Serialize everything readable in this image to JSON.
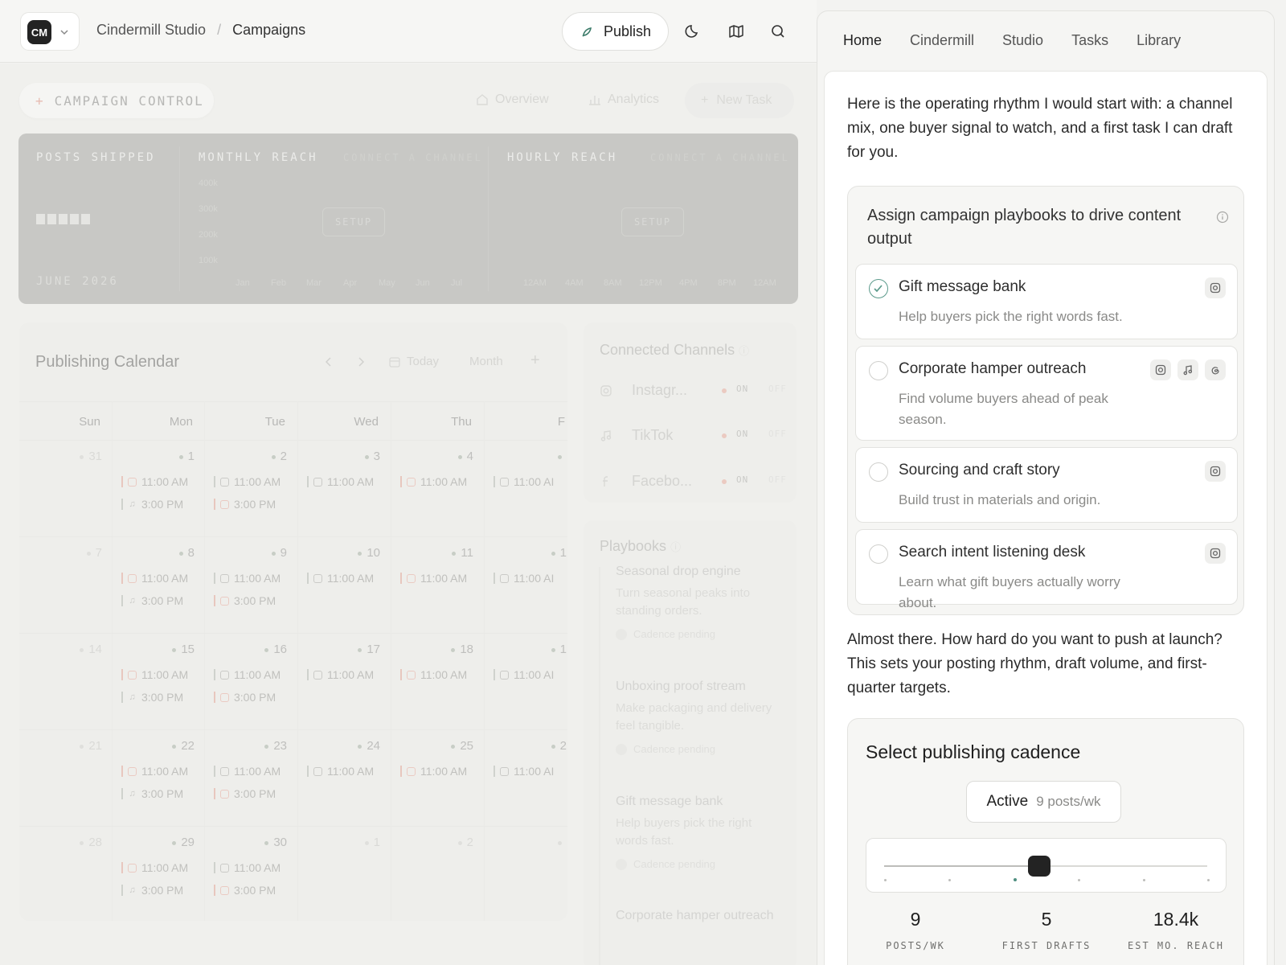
{
  "workspace": {
    "initials": "CM"
  },
  "breadcrumb": {
    "org": "Cindermill Studio",
    "separator": "/",
    "page": "Campaigns"
  },
  "toolbar": {
    "publish_label": "Publish"
  },
  "control": {
    "pill_label": "CAMPAIGN CONTROL",
    "nav": [
      "Overview",
      "Analytics"
    ],
    "new_task": "New Task"
  },
  "stats": {
    "posts_shipped": "POSTS SHIPPED",
    "month": "JUNE 2026",
    "monthly_reach": "MONTHLY REACH",
    "hourly_reach": "HOURLY REACH",
    "connect": "CONNECT A CHANNEL",
    "setup": "SETUP",
    "y_ticks": [
      "400k",
      "300k",
      "200k",
      "100k"
    ],
    "months": [
      "Jan",
      "Feb",
      "Mar",
      "Apr",
      "May",
      "Jun",
      "Jul"
    ],
    "hours": [
      "12AM",
      "4AM",
      "8AM",
      "12PM",
      "4PM",
      "8PM",
      "12AM"
    ]
  },
  "calendar": {
    "title": "Publishing Calendar",
    "today": "Today",
    "month": "Month",
    "days": [
      "Sun",
      "Mon",
      "Tue",
      "Wed",
      "Thu",
      "F"
    ],
    "weeks": [
      [
        "31",
        "1",
        "2",
        "3",
        "4",
        ""
      ],
      [
        "7",
        "8",
        "9",
        "10",
        "11",
        "1"
      ],
      [
        "14",
        "15",
        "16",
        "17",
        "18",
        "1"
      ],
      [
        "21",
        "22",
        "23",
        "24",
        "25",
        "2"
      ],
      [
        "28",
        "29",
        "30",
        "1",
        "2",
        ""
      ]
    ],
    "time_am": "11:00 AM",
    "time_pm": "3:00 PM",
    "time_cut": "11:00 AI"
  },
  "channels": {
    "title": "Connected Channels",
    "items": [
      {
        "name": "Instagr...",
        "on": "ON",
        "off": "OFF"
      },
      {
        "name": "TikTok",
        "on": "ON",
        "off": "OFF"
      },
      {
        "name": "Facebo...",
        "on": "ON",
        "off": "OFF"
      }
    ]
  },
  "playbooks": {
    "title": "Playbooks",
    "items": [
      {
        "title": "Seasonal drop engine",
        "desc": "Turn seasonal peaks into standing orders.",
        "status": "Cadence pending"
      },
      {
        "title": "Unboxing proof stream",
        "desc": "Make packaging and delivery feel tangible.",
        "status": "Cadence pending"
      },
      {
        "title": "Gift message bank",
        "desc": "Help buyers pick the right words fast.",
        "status": "Cadence pending"
      },
      {
        "title": "Corporate hamper outreach",
        "desc": "",
        "status": ""
      }
    ]
  },
  "panel": {
    "tabs": [
      "Home",
      "Cindermill",
      "Studio",
      "Tasks",
      "Library"
    ],
    "intro": "Here is the operating rhythm I would start with: a channel mix, one buyer signal to watch, and a first task I can draft for you.",
    "assign_title": "Assign campaign playbooks to drive content output",
    "tasks": [
      {
        "title": "Gift message bank",
        "desc": "Help buyers pick the right words fast.",
        "done": true
      },
      {
        "title": "Corporate hamper outreach",
        "desc": "Find volume buyers ahead of peak season.",
        "done": false
      },
      {
        "title": "Sourcing and craft story",
        "desc": "Build trust in materials and origin.",
        "done": false
      },
      {
        "title": "Search intent listening desk",
        "desc": "Learn what gift buyers actually worry about.",
        "done": false
      }
    ],
    "followup": "Almost there. How hard do you want to push at launch? This sets your posting rhythm, draft volume, and first-quarter targets.",
    "cadence": {
      "title": "Select publishing cadence",
      "level": "Active",
      "level_detail": "9 posts/wk",
      "slider_position": 3,
      "slider_steps": 5,
      "metrics": [
        {
          "value": "9",
          "label": "POSTS/WK"
        },
        {
          "value": "5",
          "label": "FIRST DRAFTS"
        },
        {
          "value": "18.4k",
          "label": "EST MO. REACH"
        }
      ]
    }
  },
  "colors": {
    "accent": "#5b9a8b",
    "instagram": "#e29a8a",
    "dark": "#232323"
  }
}
